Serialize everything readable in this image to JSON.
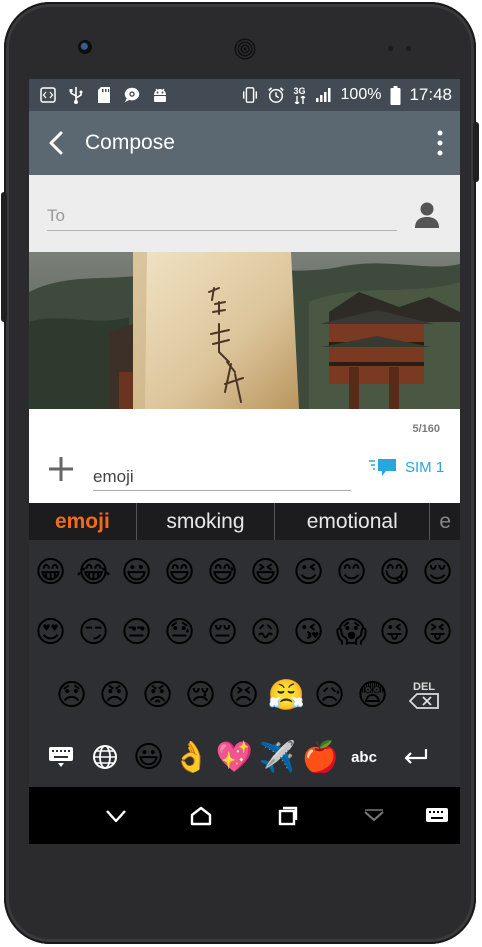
{
  "status_bar": {
    "battery_text": "100%",
    "network_type": "3G",
    "time": "17:48",
    "left_icons": [
      "code-icon",
      "usb-icon",
      "sd-card-icon",
      "chat-bubble-icon",
      "android-icon"
    ],
    "right_icons": [
      "vibrate-icon",
      "alarm-icon",
      "signal-icon",
      "battery-icon"
    ]
  },
  "app_bar": {
    "title": "Compose",
    "background": "#5b6872"
  },
  "to_field": {
    "placeholder": "To"
  },
  "compose": {
    "char_counter": "5/160",
    "message_value": "emoji",
    "sim_label": "SIM 1",
    "accent": "#27a7dd"
  },
  "keyboard": {
    "suggestions": [
      "emoji",
      "smoking",
      "emotional"
    ],
    "active_suggestion_color": "#f26b1d",
    "emoji_row_1": [
      "😁",
      "😂",
      "😃",
      "😄",
      "😅",
      "😆",
      "😉",
      "😊",
      "😋",
      "😌"
    ],
    "emoji_row_2": [
      "😍",
      "😏",
      "😒",
      "😓",
      "😔",
      "😖",
      "😘",
      "😱",
      "😜",
      "😝"
    ],
    "emoji_row_3": [
      "😞",
      "😠",
      "😡",
      "😢",
      "😣",
      "😤",
      "😥",
      "😨"
    ],
    "del_label": "DEL",
    "bottom_row": {
      "abc_label": "abc",
      "emojis": [
        "😃",
        "👌",
        "💖",
        "✈️",
        "🍎"
      ]
    }
  },
  "nav_bar": {
    "buttons": [
      "back-icon",
      "home-icon",
      "recents-icon",
      "hide-keyboard-icon",
      "keyboard-switch-icon"
    ]
  }
}
